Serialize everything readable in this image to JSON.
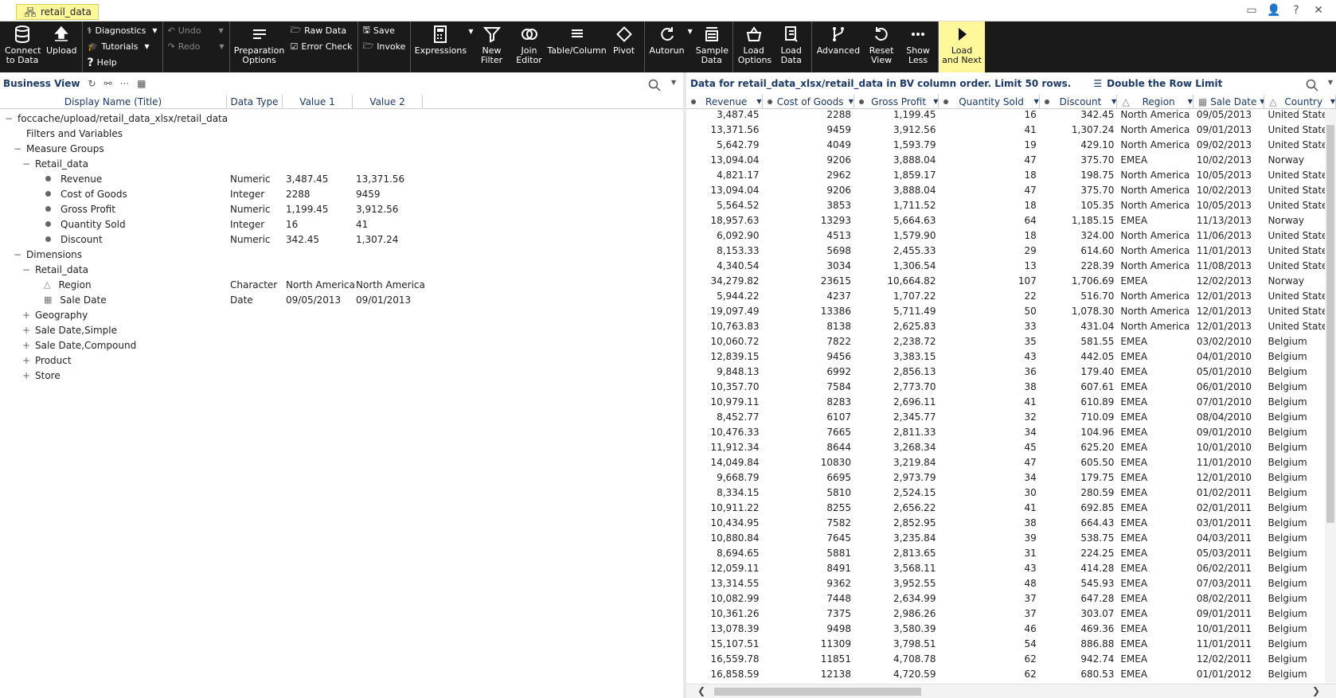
{
  "tab": {
    "title": "retail_data"
  },
  "ribbon": {
    "connect": "Connect to Data",
    "upload": "Upload",
    "diagnostics": "Diagnostics",
    "tutorials": "Tutorials",
    "help": "Help",
    "undo": "Undo",
    "redo": "Redo",
    "prep": "Preparation Options",
    "raw": "Raw Data",
    "error": "Error Check",
    "save": "Save",
    "invoke": "Invoke",
    "expressions": "Expressions",
    "newfilter": "New Filter",
    "join": "Join Editor",
    "tablecol": "Table/Column",
    "pivot": "Pivot",
    "autorun": "Autorun",
    "sample": "Sample Data",
    "loadopts": "Load Options",
    "loaddata": "Load Data",
    "advanced": "Advanced",
    "reset": "Reset View",
    "showless": "Show Less",
    "loadnext": "Load and Next"
  },
  "left": {
    "title": "Business View",
    "cols": [
      "Display Name (Title)",
      "Data Type",
      "Value 1",
      "Value 2"
    ],
    "tree": [
      {
        "indent": 0,
        "exp": "−",
        "icon": "",
        "name": "foccache/upload/retail_data_xlsx/retail_data",
        "type": "",
        "v1": "",
        "v2": ""
      },
      {
        "indent": 1,
        "exp": "",
        "icon": "",
        "name": "Filters and Variables",
        "type": "",
        "v1": "",
        "v2": ""
      },
      {
        "indent": 1,
        "exp": "−",
        "icon": "",
        "name": "Measure Groups",
        "type": "",
        "v1": "",
        "v2": ""
      },
      {
        "indent": 2,
        "exp": "−",
        "icon": "",
        "name": "Retail_data",
        "type": "",
        "v1": "",
        "v2": ""
      },
      {
        "indent": 3,
        "exp": "",
        "icon": "dot",
        "name": "Revenue",
        "type": "Numeric",
        "v1": "3,487.45",
        "v2": "13,371.56"
      },
      {
        "indent": 3,
        "exp": "",
        "icon": "dot",
        "name": "Cost of Goods",
        "type": "Integer",
        "v1": "2288",
        "v2": "9459"
      },
      {
        "indent": 3,
        "exp": "",
        "icon": "dot",
        "name": "Gross Profit",
        "type": "Numeric",
        "v1": "1,199.45",
        "v2": "3,912.56"
      },
      {
        "indent": 3,
        "exp": "",
        "icon": "dot",
        "name": "Quantity Sold",
        "type": "Integer",
        "v1": "16",
        "v2": "41"
      },
      {
        "indent": 3,
        "exp": "",
        "icon": "dot",
        "name": "Discount",
        "type": "Numeric",
        "v1": "342.45",
        "v2": "1,307.24"
      },
      {
        "indent": 1,
        "exp": "−",
        "icon": "",
        "name": "Dimensions",
        "type": "",
        "v1": "",
        "v2": ""
      },
      {
        "indent": 2,
        "exp": "−",
        "icon": "",
        "name": "Retail_data",
        "type": "",
        "v1": "",
        "v2": ""
      },
      {
        "indent": 3,
        "exp": "",
        "icon": "char",
        "name": "Region",
        "type": "Character",
        "v1": "North America",
        "v2": "North America"
      },
      {
        "indent": 3,
        "exp": "",
        "icon": "date",
        "name": "Sale Date",
        "type": "Date",
        "v1": "09/05/2013",
        "v2": "09/01/2013"
      },
      {
        "indent": 2,
        "exp": "+",
        "icon": "",
        "name": "Geography",
        "type": "",
        "v1": "",
        "v2": ""
      },
      {
        "indent": 2,
        "exp": "+",
        "icon": "",
        "name": "Sale Date,Simple",
        "type": "",
        "v1": "",
        "v2": ""
      },
      {
        "indent": 2,
        "exp": "+",
        "icon": "",
        "name": "Sale Date,Compound",
        "type": "",
        "v1": "",
        "v2": ""
      },
      {
        "indent": 2,
        "exp": "+",
        "icon": "",
        "name": "Product",
        "type": "",
        "v1": "",
        "v2": ""
      },
      {
        "indent": 2,
        "exp": "+",
        "icon": "",
        "name": "Store",
        "type": "",
        "v1": "",
        "v2": ""
      }
    ]
  },
  "right": {
    "title": "Data for retail_data_xlsx/retail_data in BV column order. Limit 50 rows.",
    "double": "Double the Row Limit",
    "cols": [
      "Revenue",
      "Cost of Goods",
      "Gross Profit",
      "Quantity Sold",
      "Discount",
      "Region",
      "Sale Date",
      "Country"
    ],
    "rows": [
      [
        "3,487.45",
        "2288",
        "1,199.45",
        "16",
        "342.45",
        "North America",
        "09/05/2013",
        "United States"
      ],
      [
        "13,371.56",
        "9459",
        "3,912.56",
        "41",
        "1,307.24",
        "North America",
        "09/01/2013",
        "United States"
      ],
      [
        "5,642.79",
        "4049",
        "1,593.79",
        "19",
        "429.10",
        "North America",
        "09/02/2013",
        "United States"
      ],
      [
        "13,094.04",
        "9206",
        "3,888.04",
        "47",
        "375.70",
        "EMEA",
        "10/02/2013",
        "Norway"
      ],
      [
        "4,821.17",
        "2962",
        "1,859.17",
        "18",
        "198.75",
        "North America",
        "10/05/2013",
        "United States"
      ],
      [
        "13,094.04",
        "9206",
        "3,888.04",
        "47",
        "375.70",
        "North America",
        "10/02/2013",
        "United States"
      ],
      [
        "5,564.52",
        "3853",
        "1,711.52",
        "18",
        "105.35",
        "North America",
        "10/05/2013",
        "United States"
      ],
      [
        "18,957.63",
        "13293",
        "5,664.63",
        "64",
        "1,185.15",
        "EMEA",
        "11/13/2013",
        "Norway"
      ],
      [
        "6,092.90",
        "4513",
        "1,579.90",
        "18",
        "324.00",
        "North America",
        "11/06/2013",
        "United States"
      ],
      [
        "8,153.33",
        "5698",
        "2,455.33",
        "29",
        "614.60",
        "North America",
        "11/01/2013",
        "United States"
      ],
      [
        "4,340.54",
        "3034",
        "1,306.54",
        "13",
        "228.39",
        "North America",
        "11/08/2013",
        "United States"
      ],
      [
        "34,279.82",
        "23615",
        "10,664.82",
        "107",
        "1,706.69",
        "EMEA",
        "12/02/2013",
        "Norway"
      ],
      [
        "5,944.22",
        "4237",
        "1,707.22",
        "22",
        "516.70",
        "North America",
        "12/01/2013",
        "United States"
      ],
      [
        "19,097.49",
        "13386",
        "5,711.49",
        "50",
        "1,078.30",
        "North America",
        "12/01/2013",
        "United States"
      ],
      [
        "10,763.83",
        "8138",
        "2,625.83",
        "33",
        "431.04",
        "North America",
        "12/01/2013",
        "United States"
      ],
      [
        "10,060.72",
        "7822",
        "2,238.72",
        "35",
        "581.55",
        "EMEA",
        "03/02/2010",
        "Belgium"
      ],
      [
        "12,839.15",
        "9456",
        "3,383.15",
        "43",
        "442.05",
        "EMEA",
        "04/01/2010",
        "Belgium"
      ],
      [
        "9,848.13",
        "6992",
        "2,856.13",
        "36",
        "179.40",
        "EMEA",
        "05/01/2010",
        "Belgium"
      ],
      [
        "10,357.70",
        "7584",
        "2,773.70",
        "38",
        "607.61",
        "EMEA",
        "06/01/2010",
        "Belgium"
      ],
      [
        "10,979.11",
        "8283",
        "2,696.11",
        "41",
        "610.89",
        "EMEA",
        "07/01/2010",
        "Belgium"
      ],
      [
        "8,452.77",
        "6107",
        "2,345.77",
        "32",
        "710.09",
        "EMEA",
        "08/04/2010",
        "Belgium"
      ],
      [
        "10,476.33",
        "7665",
        "2,811.33",
        "34",
        "104.96",
        "EMEA",
        "09/01/2010",
        "Belgium"
      ],
      [
        "11,912.34",
        "8644",
        "3,268.34",
        "45",
        "625.20",
        "EMEA",
        "10/01/2010",
        "Belgium"
      ],
      [
        "14,049.84",
        "10830",
        "3,219.84",
        "47",
        "605.50",
        "EMEA",
        "11/01/2010",
        "Belgium"
      ],
      [
        "9,668.79",
        "6695",
        "2,973.79",
        "34",
        "179.75",
        "EMEA",
        "12/01/2010",
        "Belgium"
      ],
      [
        "8,334.15",
        "5810",
        "2,524.15",
        "30",
        "280.59",
        "EMEA",
        "01/02/2011",
        "Belgium"
      ],
      [
        "10,911.22",
        "8255",
        "2,656.22",
        "41",
        "692.85",
        "EMEA",
        "02/01/2011",
        "Belgium"
      ],
      [
        "10,434.95",
        "7582",
        "2,852.95",
        "38",
        "664.43",
        "EMEA",
        "03/01/2011",
        "Belgium"
      ],
      [
        "10,880.84",
        "7645",
        "3,235.84",
        "39",
        "538.75",
        "EMEA",
        "04/03/2011",
        "Belgium"
      ],
      [
        "8,694.65",
        "5881",
        "2,813.65",
        "31",
        "224.25",
        "EMEA",
        "05/03/2011",
        "Belgium"
      ],
      [
        "12,059.11",
        "8491",
        "3,568.11",
        "43",
        "414.28",
        "EMEA",
        "06/02/2011",
        "Belgium"
      ],
      [
        "13,314.55",
        "9362",
        "3,952.55",
        "48",
        "545.93",
        "EMEA",
        "07/03/2011",
        "Belgium"
      ],
      [
        "10,082.99",
        "7448",
        "2,634.99",
        "37",
        "647.28",
        "EMEA",
        "08/02/2011",
        "Belgium"
      ],
      [
        "10,361.26",
        "7375",
        "2,986.26",
        "37",
        "303.07",
        "EMEA",
        "09/01/2011",
        "Belgium"
      ],
      [
        "13,078.39",
        "9498",
        "3,580.39",
        "46",
        "469.36",
        "EMEA",
        "10/01/2011",
        "Belgium"
      ],
      [
        "15,107.51",
        "11309",
        "3,798.51",
        "54",
        "886.88",
        "EMEA",
        "11/01/2011",
        "Belgium"
      ],
      [
        "16,559.78",
        "11851",
        "4,708.78",
        "62",
        "942.74",
        "EMEA",
        "12/02/2011",
        "Belgium"
      ],
      [
        "16,858.59",
        "12138",
        "4,720.59",
        "62",
        "680.53",
        "EMEA",
        "01/01/2012",
        "Belgium"
      ]
    ]
  }
}
